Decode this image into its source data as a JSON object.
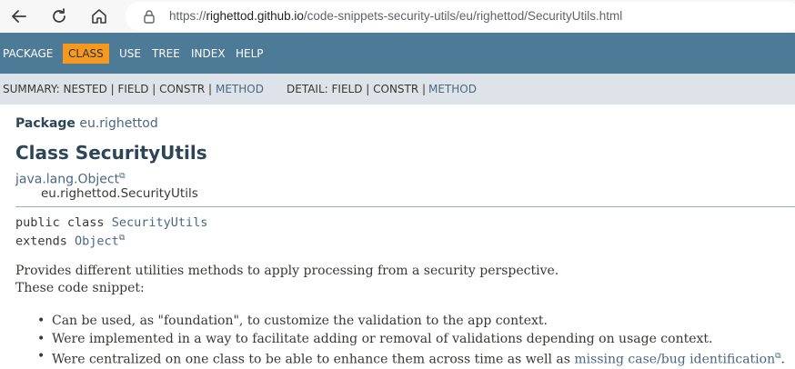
{
  "browser": {
    "url_prefix": "https://",
    "url_host": "righettod.github.io",
    "url_path": "/code-snippets-security-utils/eu/righettod/SecurityUtils.html"
  },
  "top_nav": {
    "items": [
      "PACKAGE",
      "CLASS",
      "USE",
      "TREE",
      "INDEX",
      "HELP"
    ],
    "active": "CLASS"
  },
  "sub_nav": {
    "summary_label": "SUMMARY: NESTED | FIELD | CONSTR |",
    "summary_method": "METHOD",
    "detail_label": "DETAIL: FIELD | CONSTR |",
    "detail_method": "METHOD"
  },
  "content": {
    "package_label": "Package",
    "package_name": "eu.righettod",
    "class_title": "Class SecurityUtils",
    "inheritance_parent": "java.lang.Object",
    "inheritance_child": "eu.righettod.SecurityUtils",
    "signature_line1_prefix": "public class",
    "signature_class": "SecurityUtils",
    "signature_line2_prefix": "extends",
    "signature_extends": "Object",
    "description_1": "Provides different utilities methods to apply processing from a security perspective.",
    "description_2": "These code snippet:",
    "bullets": [
      "Can be used, as \"foundation\", to customize the validation to the app context.",
      "Were implemented in a way to facilitate adding or removal of validations depending on usage context."
    ],
    "bullet3_prefix": "Were centralized on one class to be able to enhance them across time as well as",
    "bullet3_link": "missing case/bug identification",
    "bullet3_suffix": "."
  },
  "colors": {
    "nav_bg": "#4d7a97",
    "active_tab": "#f8981d",
    "sub_nav_bg": "#dee3e9",
    "link": "#4a6782",
    "heading": "#2c4557"
  }
}
